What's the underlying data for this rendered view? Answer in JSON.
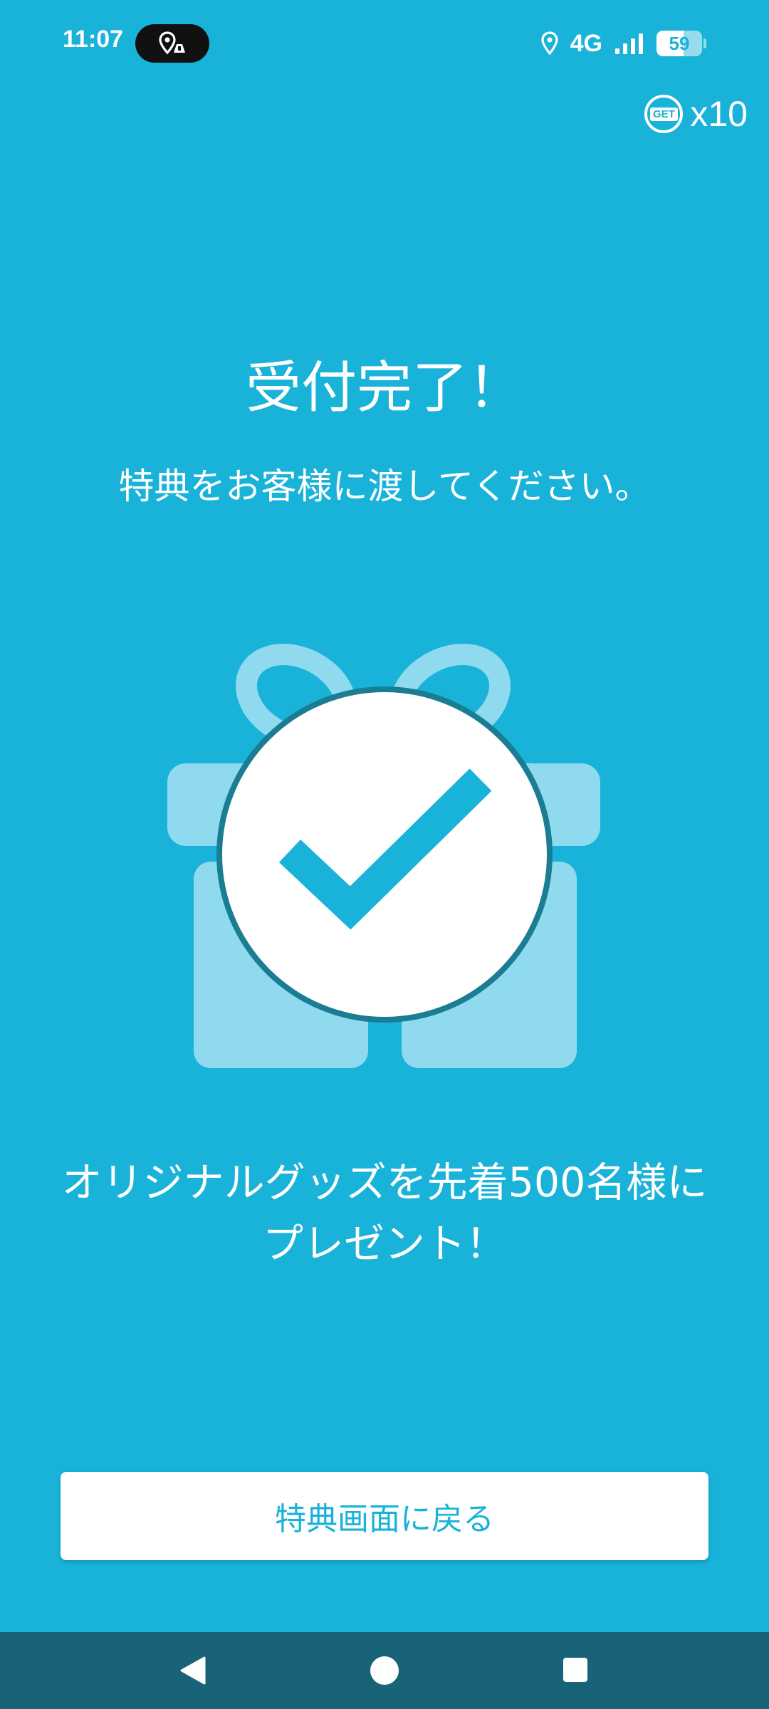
{
  "status_bar": {
    "time": "11:07",
    "network": "4G",
    "battery_percent": "59",
    "battery_level": 0.59,
    "icons": [
      "location-pin-icon",
      "signal-icon",
      "battery-icon"
    ],
    "pill_icon": "location-share-icon"
  },
  "header": {
    "get_badge_label": "GET",
    "get_count": "x10"
  },
  "main": {
    "title": "受付完了！",
    "subtitle": "特典をお客様に渡してください。",
    "illustration_icon": "gift-check-icon",
    "promo_line1": "オリジナルグッズを先着500名様に",
    "promo_line2": "プレゼント！"
  },
  "actions": {
    "back_button_label": "特典画面に戻る"
  },
  "colors": {
    "background": "#19b2d9",
    "gift": "#8fdaee",
    "check": "#19b2d9",
    "button_text": "#19b2d9",
    "nav_bar": "#186377"
  }
}
